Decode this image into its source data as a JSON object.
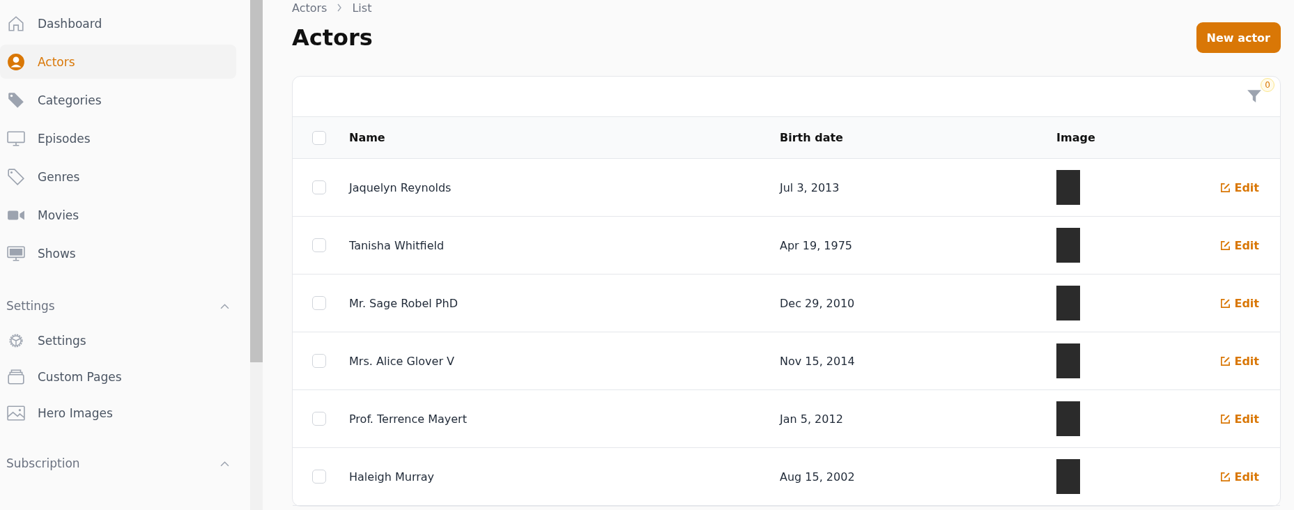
{
  "sidebar": {
    "items": [
      {
        "label": "Dashboard",
        "selected": false
      },
      {
        "label": "Actors",
        "selected": true
      },
      {
        "label": "Categories",
        "selected": false
      },
      {
        "label": "Episodes",
        "selected": false
      },
      {
        "label": "Genres",
        "selected": false
      },
      {
        "label": "Movies",
        "selected": false
      },
      {
        "label": "Shows",
        "selected": false
      }
    ],
    "groups": [
      {
        "label": "Settings",
        "expanded": true,
        "items": [
          {
            "label": "Settings",
            "selected": false
          },
          {
            "label": "Custom Pages",
            "selected": false
          },
          {
            "label": "Hero Images",
            "selected": false
          }
        ]
      },
      {
        "label": "Subscription",
        "expanded": true
      }
    ]
  },
  "breadcrumb": [
    "Actors",
    "List"
  ],
  "title": "Actors",
  "new_button": "New actor",
  "filter_count": "0",
  "table": {
    "select_all_checked": false,
    "columns": [
      "Name",
      "Birth date",
      "Image"
    ],
    "rows": [
      {
        "name": "Jaquelyn Reynolds",
        "birth_date": "Jul 3, 2013",
        "checked": false,
        "action": "Edit"
      },
      {
        "name": "Tanisha Whitfield",
        "birth_date": "Apr 19, 1975",
        "checked": false,
        "action": "Edit"
      },
      {
        "name": "Mr. Sage Robel PhD",
        "birth_date": "Dec 29, 2010",
        "checked": false,
        "action": "Edit"
      },
      {
        "name": "Mrs. Alice Glover V",
        "birth_date": "Nov 15, 2014",
        "checked": false,
        "action": "Edit"
      },
      {
        "name": "Prof. Terrence Mayert",
        "birth_date": "Jan 5, 2012",
        "checked": false,
        "action": "Edit"
      },
      {
        "name": "Haleigh Murray",
        "birth_date": "Aug 15, 2002",
        "checked": false,
        "action": "Edit"
      }
    ]
  }
}
